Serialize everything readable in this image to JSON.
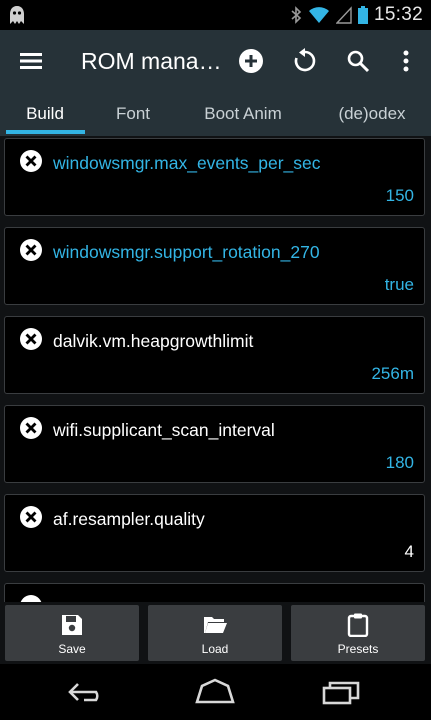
{
  "status_bar": {
    "time": "15:32"
  },
  "action_bar": {
    "title": "ROM mana…"
  },
  "tabs": [
    {
      "label": "Build",
      "active": true
    },
    {
      "label": "Font",
      "active": false
    },
    {
      "label": "Boot Anim",
      "active": false
    },
    {
      "label": "(de)odex",
      "active": false
    }
  ],
  "properties": [
    {
      "key": "windowsmgr.max_events_per_sec",
      "value": "150",
      "highlighted": true
    },
    {
      "key": "windowsmgr.support_rotation_270",
      "value": "true",
      "highlighted": true
    },
    {
      "key": "dalvik.vm.heapgrowthlimit",
      "value": "256m",
      "highlighted": false
    },
    {
      "key": "wifi.supplicant_scan_interval",
      "value": "180",
      "highlighted": false
    },
    {
      "key": "af.resampler.quality",
      "value": "4",
      "highlighted": false
    }
  ],
  "bottom_buttons": {
    "save": "Save",
    "load": "Load",
    "presets": "Presets"
  },
  "colors": {
    "accent": "#33b5e5",
    "action_bar": "#263238",
    "card_border": "#3a3d40",
    "button_bg": "#3a3d40"
  }
}
